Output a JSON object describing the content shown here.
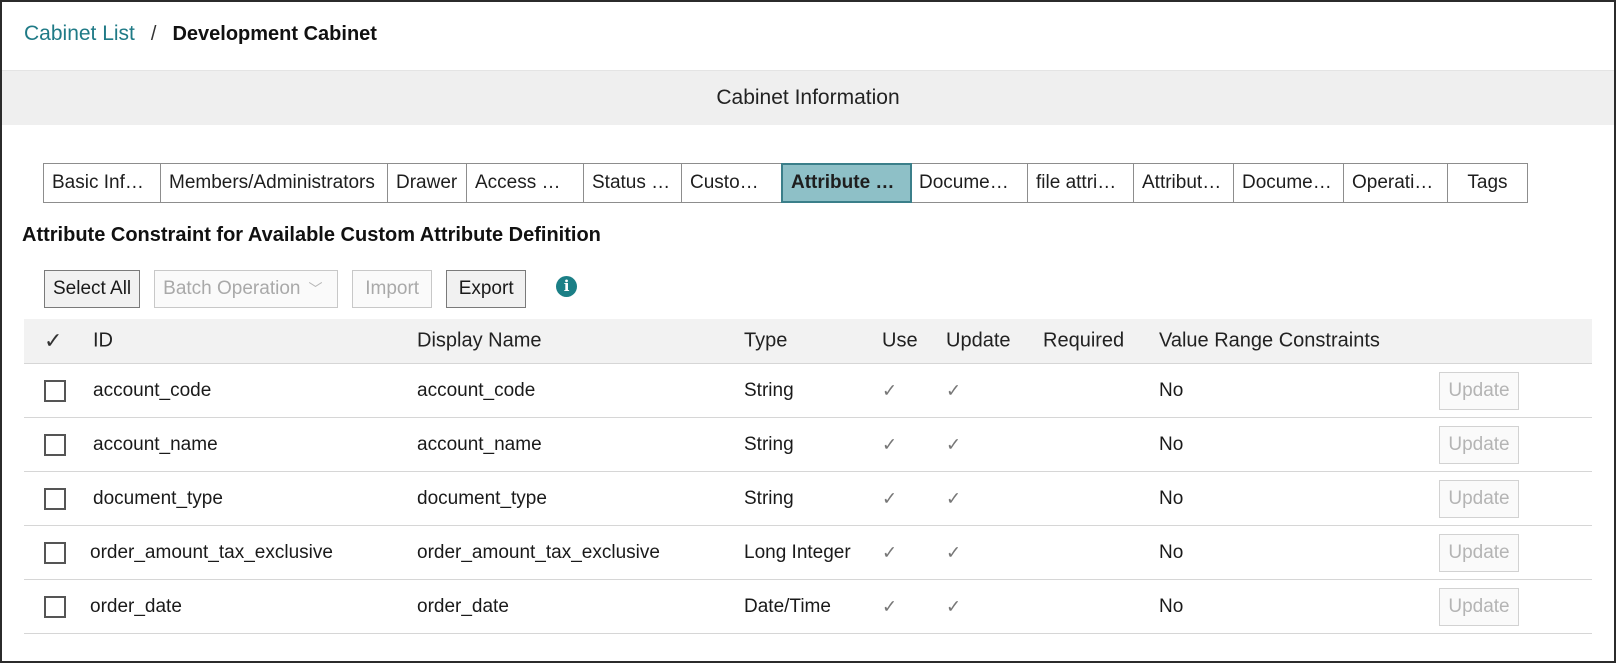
{
  "breadcrumb": {
    "parent": "Cabinet List",
    "separator": "/",
    "current": "Development Cabinet"
  },
  "section_title": "Cabinet Information",
  "tabs": [
    {
      "label": "Basic Inf…",
      "active": false
    },
    {
      "label": "Members/Administrators",
      "active": false
    },
    {
      "label": "Drawer",
      "active": false
    },
    {
      "label": "Access …",
      "active": false
    },
    {
      "label": "Status …",
      "active": false
    },
    {
      "label": "Custo…",
      "active": false
    },
    {
      "label": "Attribute …",
      "active": true
    },
    {
      "label": "Docume…",
      "active": false
    },
    {
      "label": "file attri…",
      "active": false
    },
    {
      "label": "Attribut…",
      "active": false
    },
    {
      "label": "Docume…",
      "active": false
    },
    {
      "label": "Operati…",
      "active": false
    },
    {
      "label": "Tags",
      "active": false
    }
  ],
  "subtitle": "Attribute Constraint for Available Custom Attribute Definition",
  "toolbar": {
    "select_all": "Select All",
    "batch_operation": "Batch Operation",
    "import": "Import",
    "export": "Export",
    "info_icon": "i"
  },
  "table": {
    "headers": {
      "check": "✓",
      "id": "ID",
      "display_name": "Display Name",
      "type": "Type",
      "use": "Use",
      "update": "Update",
      "required": "Required",
      "value_range": "Value Range Constraints"
    },
    "rows": [
      {
        "id": "account_code",
        "display_name": "account_code",
        "type": "String",
        "use": "✓",
        "update": "✓",
        "required": "",
        "value_range": "No",
        "action": "Update"
      },
      {
        "id": "account_name",
        "display_name": "account_name",
        "type": "String",
        "use": "✓",
        "update": "✓",
        "required": "",
        "value_range": "No",
        "action": "Update"
      },
      {
        "id": "document_type",
        "display_name": "document_type",
        "type": "String",
        "use": "✓",
        "update": "✓",
        "required": "",
        "value_range": "No",
        "action": "Update"
      },
      {
        "id": "order_amount_tax_exclusive",
        "display_name": "order_amount_tax_exclusive",
        "type": "Long Integer",
        "use": "✓",
        "update": "✓",
        "required": "",
        "value_range": "No",
        "action": "Update"
      },
      {
        "id": "order_date",
        "display_name": "order_date",
        "type": "Date/Time",
        "use": "✓",
        "update": "✓",
        "required": "",
        "value_range": "No",
        "action": "Update"
      }
    ]
  },
  "colors": {
    "link": "#1f7a86",
    "active_tab": "#8ec0c7",
    "info_icon": "#1b7f86"
  }
}
